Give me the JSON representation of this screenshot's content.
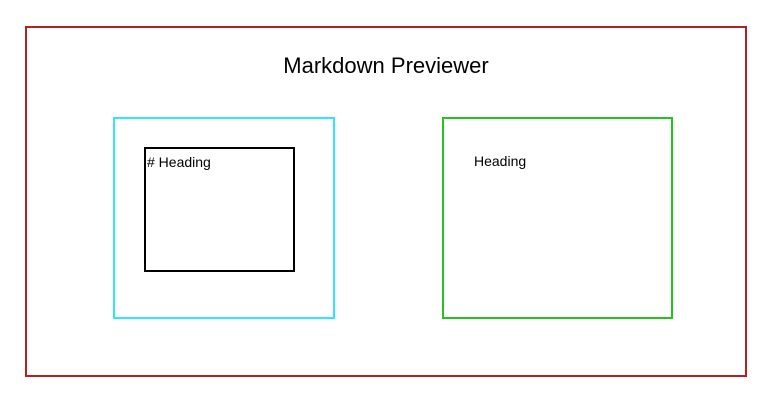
{
  "app": {
    "title": "Markdown Previewer"
  },
  "editor": {
    "value": "# Heading"
  },
  "preview": {
    "heading": "Heading"
  },
  "colors": {
    "frame_border": "#b22222",
    "editor_border": "#33e6ff",
    "textarea_border": "#000000",
    "preview_border": "#22c422"
  }
}
